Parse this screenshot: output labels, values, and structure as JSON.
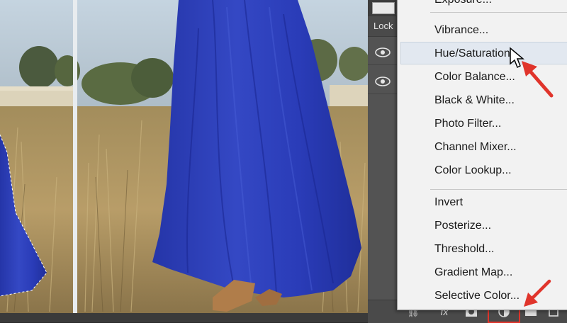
{
  "panel": {
    "lock_label": "Lock"
  },
  "menu": {
    "items_top": [
      {
        "label": "Exposure..."
      },
      {
        "label": "Vibrance..."
      },
      {
        "label": "Hue/Saturation..."
      },
      {
        "label": "Color Balance..."
      },
      {
        "label": "Black & White..."
      },
      {
        "label": "Photo Filter..."
      },
      {
        "label": "Channel Mixer..."
      },
      {
        "label": "Color Lookup..."
      }
    ],
    "items_bottom": [
      {
        "label": "Invert"
      },
      {
        "label": "Posterize..."
      },
      {
        "label": "Threshold..."
      },
      {
        "label": "Gradient Map..."
      },
      {
        "label": "Selective Color..."
      }
    ]
  },
  "bottom_bar": {
    "fx_label": "fx"
  },
  "colors": {
    "dress": "#2a3cb8",
    "highlight": "#fff000",
    "annotation": "#e0342b"
  },
  "icons": [
    "eye-icon",
    "link-icon",
    "fx-icon",
    "mask-icon",
    "adjustment-layer-icon",
    "group-folder-icon",
    "new-layer-icon",
    "trash-icon"
  ]
}
